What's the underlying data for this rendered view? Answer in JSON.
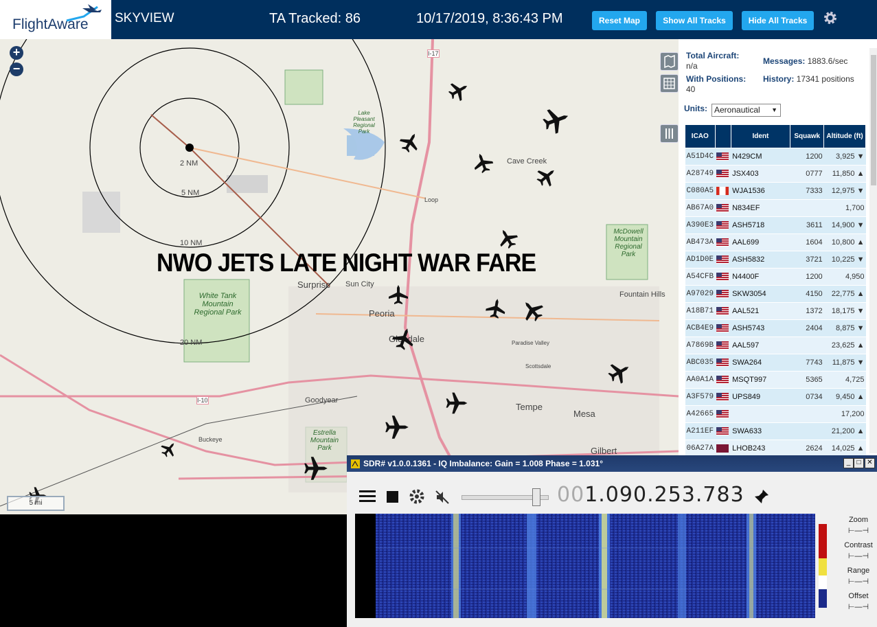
{
  "header": {
    "logo_text": "FlightAware",
    "app_name": "SKYVIEW",
    "tracked": "TA Tracked: 86",
    "datetime": "10/17/2019, 8:36:43 PM",
    "buttons": {
      "reset": "Reset Map",
      "show": "Show All Tracks",
      "hide": "Hide All Tracks"
    }
  },
  "map": {
    "overlay_text": "NWO JETS LATE NIGHT WAR FARE",
    "zoom_in": "+",
    "zoom_out": "−",
    "rings": [
      "2 NM",
      "5 NM",
      "10 NM",
      "20 NM"
    ],
    "places": [
      "Surprise",
      "Sun City",
      "Peoria",
      "Glendale",
      "Goodyear",
      "Tempe",
      "Mesa",
      "Cave Creek",
      "Fountain Hills",
      "Buckeye",
      "Scottsdale",
      "Paradise Valley",
      "Gilbert"
    ],
    "parks": [
      "White Tank Mountain Regional Park",
      "McDowell Mountain Regional Park",
      "Estrella Mountain Park",
      "Lake Pleasant Regional Park"
    ],
    "roads": [
      "I-17",
      "I-10",
      "Loop"
    ],
    "scale": "5 mi"
  },
  "sidebar": {
    "total_aircraft_label": "Total Aircraft:",
    "total_aircraft_value": "n/a",
    "messages_label": "Messages:",
    "messages_value": "1883.6/sec",
    "with_positions_label": "With Positions:",
    "with_positions_value": "40",
    "history_label": "History:",
    "history_value": "17341 positions",
    "units_label": "Units:",
    "units_value": "Aeronautical",
    "columns": [
      "ICAO",
      "",
      "Ident",
      "Squawk",
      "Altitude (ft)"
    ],
    "rows": [
      {
        "icao": "A51D4C",
        "flag": "us",
        "ident": "N429CM",
        "squawk": "1200",
        "alt": "3,925 ▼"
      },
      {
        "icao": "A28749",
        "flag": "us",
        "ident": "JSX403",
        "squawk": "0777",
        "alt": "11,850 ▲"
      },
      {
        "icao": "C080A5",
        "flag": "ca",
        "ident": "WJA1536",
        "squawk": "7333",
        "alt": "12,975 ▼"
      },
      {
        "icao": "AB67A0",
        "flag": "us",
        "ident": "N834EF",
        "squawk": "",
        "alt": "1,700"
      },
      {
        "icao": "A390E3",
        "flag": "us",
        "ident": "ASH5718",
        "squawk": "3611",
        "alt": "14,900 ▼"
      },
      {
        "icao": "AB473A",
        "flag": "us",
        "ident": "AAL699",
        "squawk": "1604",
        "alt": "10,800 ▲"
      },
      {
        "icao": "AD1D0E",
        "flag": "us",
        "ident": "ASH5832",
        "squawk": "3721",
        "alt": "10,225 ▼"
      },
      {
        "icao": "A54CFB",
        "flag": "us",
        "ident": "N4400F",
        "squawk": "1200",
        "alt": "4,950"
      },
      {
        "icao": "A97029",
        "flag": "us",
        "ident": "SKW3054",
        "squawk": "4150",
        "alt": "22,775 ▲"
      },
      {
        "icao": "A18B71",
        "flag": "us",
        "ident": "AAL521",
        "squawk": "1372",
        "alt": "18,175 ▼"
      },
      {
        "icao": "ACB4E9",
        "flag": "us",
        "ident": "ASH5743",
        "squawk": "2404",
        "alt": "8,875 ▼"
      },
      {
        "icao": "A7869B",
        "flag": "us",
        "ident": "AAL597",
        "squawk": "",
        "alt": "23,625 ▲"
      },
      {
        "icao": "ABC035",
        "flag": "us",
        "ident": "SWA264",
        "squawk": "7743",
        "alt": "11,875 ▼"
      },
      {
        "icao": "AA0A1A",
        "flag": "us",
        "ident": "MSQT997",
        "squawk": "5365",
        "alt": "4,725"
      },
      {
        "icao": "A3F579",
        "flag": "us",
        "ident": "UPS849",
        "squawk": "0734",
        "alt": "9,450 ▲"
      },
      {
        "icao": "A42665",
        "flag": "us",
        "ident": "",
        "squawk": "",
        "alt": "17,200"
      },
      {
        "icao": "A211EF",
        "flag": "us",
        "ident": "SWA633",
        "squawk": "",
        "alt": "21,200 ▲"
      },
      {
        "icao": "06A27A",
        "flag": "qa",
        "ident": "LHOB243",
        "squawk": "2624",
        "alt": "14,025 ▲"
      }
    ]
  },
  "sdr": {
    "title": "SDR# v1.0.0.1361 - IQ Imbalance: Gain = 1.008 Phase = 1.031°",
    "freq_dim": "00",
    "freq_main": "1.090.253.783",
    "right_labels": [
      "Zoom",
      "Contrast",
      "Range",
      "Offset"
    ]
  },
  "colors": {
    "header_bg": "#002f5d",
    "button_bg": "#23a7ee",
    "table_header": "#003466",
    "sdr_title": "#1f3a6b"
  }
}
